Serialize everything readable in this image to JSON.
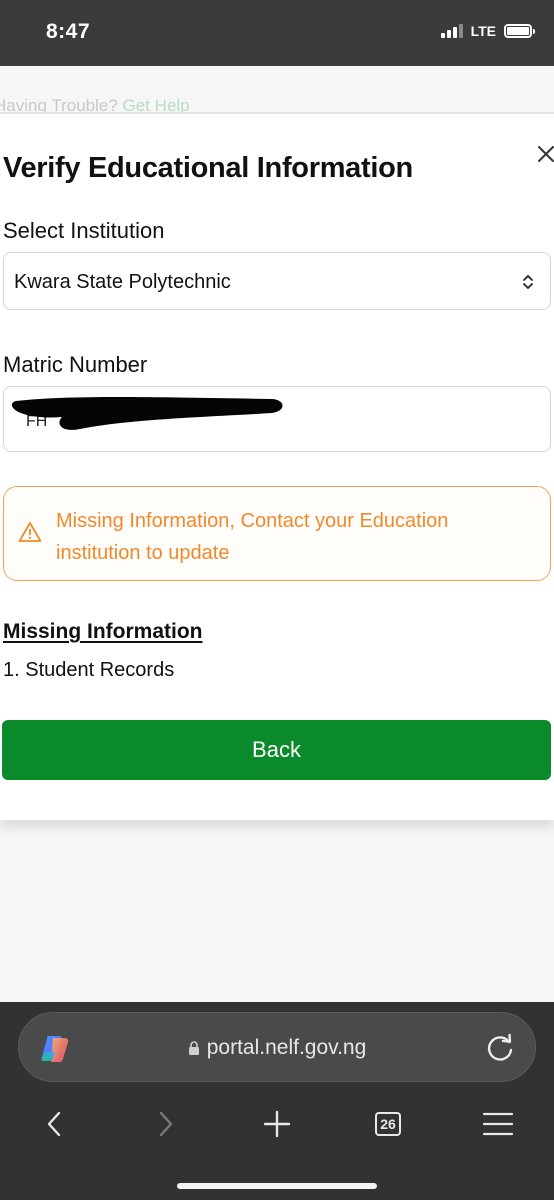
{
  "status_bar": {
    "time": "8:47",
    "network": "LTE",
    "signal_bars_active": 3,
    "signal_bars_total": 4
  },
  "background_page": {
    "text": "Having Trouble?",
    "link": "Get Help"
  },
  "modal": {
    "title": "Verify Educational Information",
    "close_icon": "close-icon",
    "institution": {
      "label": "Select Institution",
      "value": "Kwara State Polytechnic"
    },
    "matric": {
      "label": "Matric Number",
      "value": "FH"
    },
    "alert": {
      "icon": "warning-icon",
      "message": "Missing Information, Contact your Education institution to update",
      "color": "#ef8a2c"
    },
    "missing": {
      "heading": "Missing Information",
      "items": [
        "1. Student Records"
      ]
    },
    "back_button": {
      "label": "Back",
      "color": "#0b8a2c"
    }
  },
  "browser": {
    "url": "portal.nelf.gov.ng",
    "tab_count": "26",
    "icons": [
      "copilot-icon",
      "lock-icon",
      "reload-icon",
      "back-arrow-icon",
      "forward-arrow-icon",
      "new-tab-icon",
      "tabs-icon",
      "menu-icon"
    ]
  }
}
